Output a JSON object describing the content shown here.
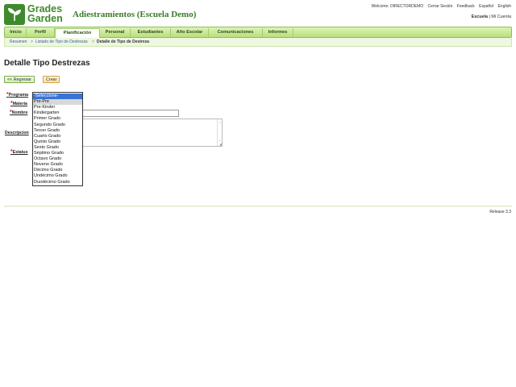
{
  "brand": {
    "logo_line1": "Grades",
    "logo_line2": "Garden",
    "app_title": "Adiestramientos (Escuela Demo)"
  },
  "header": {
    "welcome": "Welcome: DIRECTORDEMO",
    "links": [
      "Cerrar Sesión",
      "Feedback",
      "Español",
      "English"
    ],
    "escuela": "Escuela",
    "separator": "|",
    "mi_cuenta": "Mi Cuenta"
  },
  "nav": {
    "tabs": [
      {
        "label": "Inicio"
      },
      {
        "label": "Perfil"
      },
      {
        "label": "Planificación"
      },
      {
        "label": "Personal"
      },
      {
        "label": "Estudiantes"
      },
      {
        "label": "Año Escolar"
      },
      {
        "label": "Comunicaciones"
      },
      {
        "label": "Informes"
      }
    ],
    "active": "Planificación"
  },
  "breadcrumb": [
    "Resumen",
    "Listado de Tipo de Destrezas",
    "Detalle de Tipo de Destreza"
  ],
  "breadcrumb_sep": ">",
  "page": {
    "title": "Detalle Tipo Destrezas"
  },
  "buttons": {
    "back": "<< Regresar",
    "create": "Crear"
  },
  "form": {
    "required_mark": "*",
    "labels": {
      "programa": "Programa",
      "materia": "Materia",
      "nombre": "Nombre",
      "descripcion": "Descripcion",
      "estatus": "Estatus"
    }
  },
  "programa_dropdown": {
    "options": [
      "-Seleccione-",
      "Pre-Pre",
      "Pre-Kinder",
      "Kindergarten",
      "Primer Grado",
      "Segundo Grado",
      "Tercer Grado",
      "Cuarto Grado",
      "Quinto Grado",
      "Sexto Grado",
      "Séptimo Grado",
      "Octavo Grado",
      "Noveno Grado",
      "Décimo Grado",
      "Undécimo Grado",
      "Duodécimo Grado"
    ],
    "selected": "-Seleccione-",
    "hovered": "Pre-Pre"
  },
  "footer": {
    "release": "Release 3.3"
  },
  "colors": {
    "brand_green": "#3f8a2d",
    "nav_green": "#b8e07c",
    "selected_blue": "#3874d8",
    "required_red": "#c0272d"
  }
}
